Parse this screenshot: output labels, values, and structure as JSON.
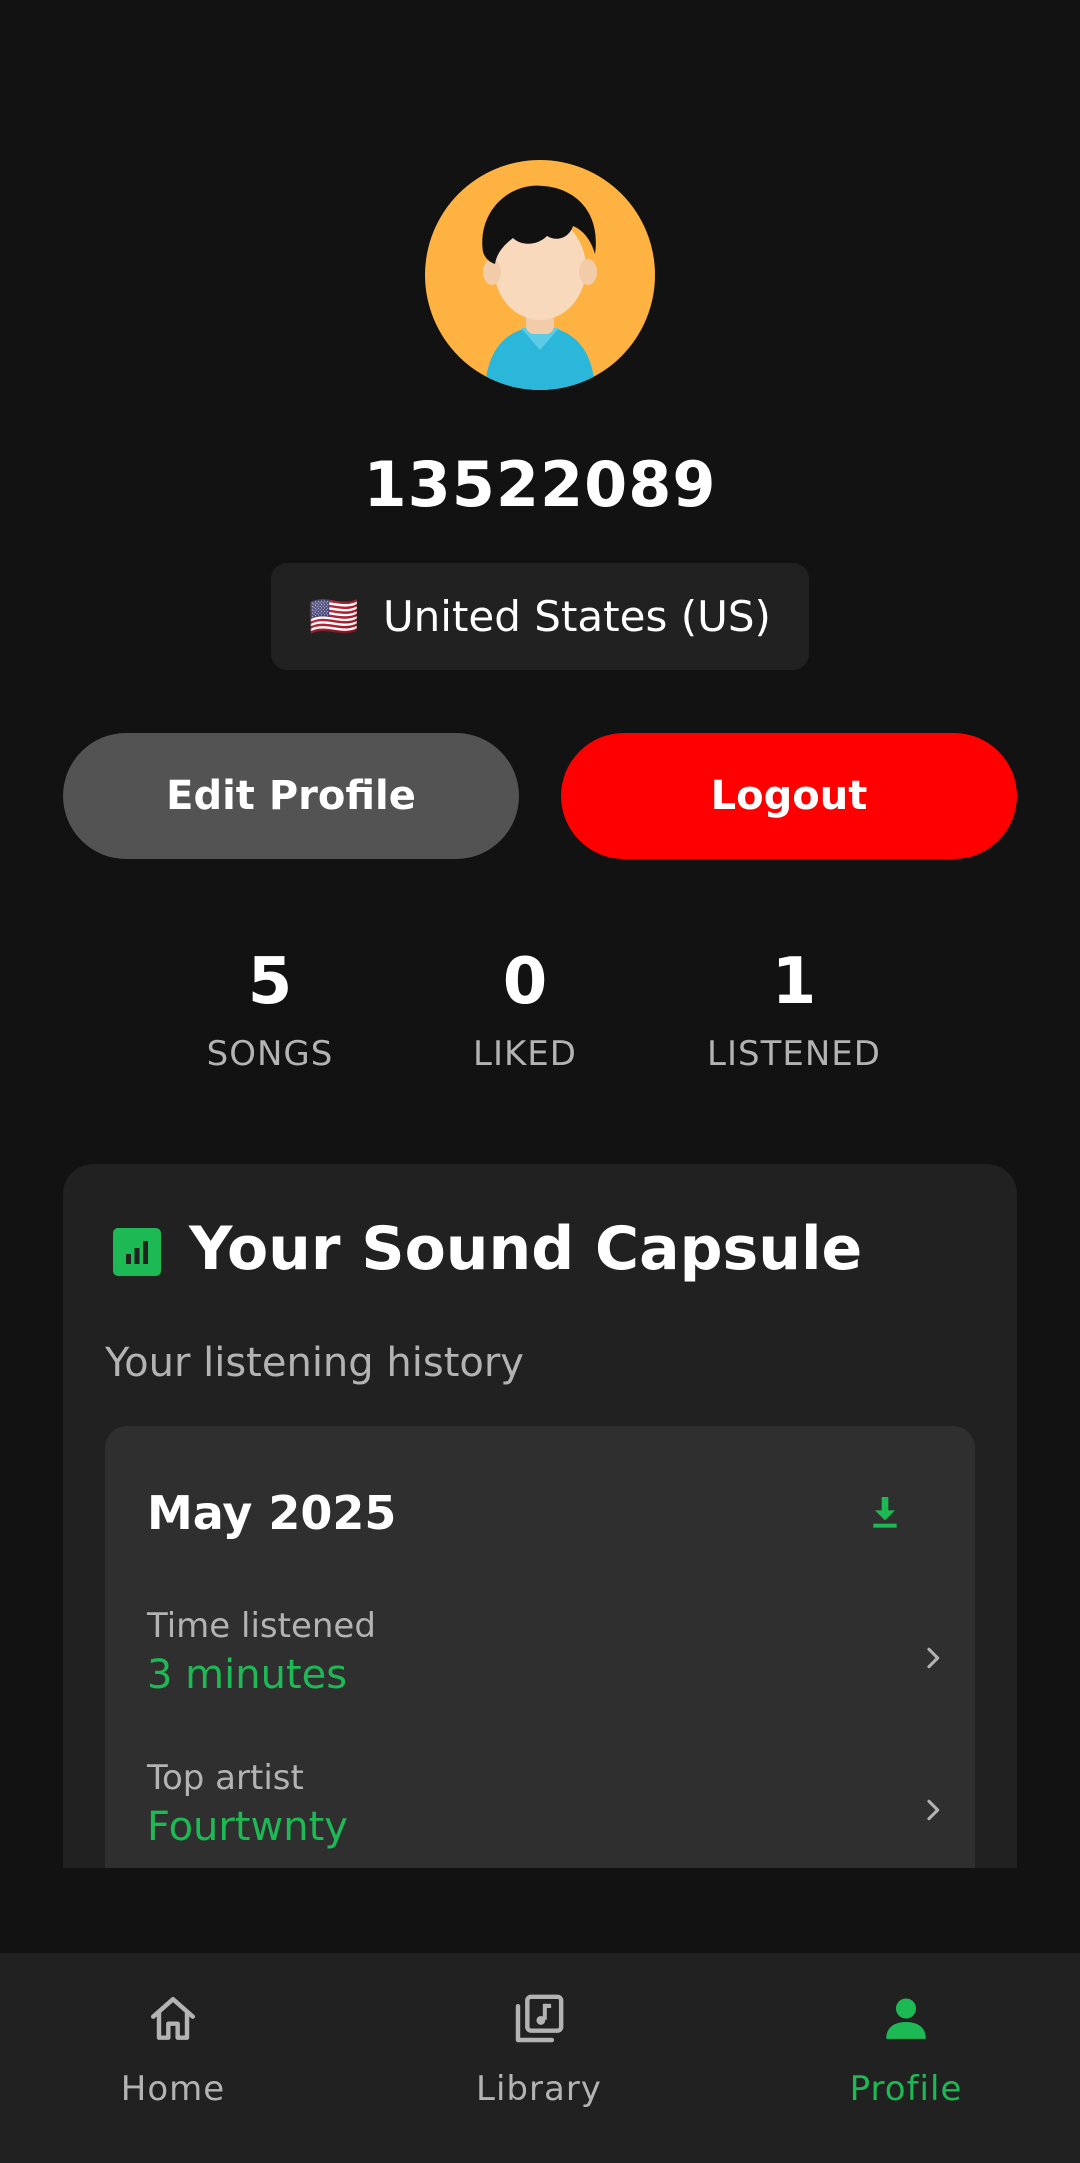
{
  "profile": {
    "username": "13522089",
    "country": {
      "flag": "🇺🇸",
      "label": "United States (US)"
    }
  },
  "actions": {
    "edit_label": "Edit Profile",
    "logout_label": "Logout"
  },
  "stats": [
    {
      "value": "5",
      "label": "SONGS"
    },
    {
      "value": "0",
      "label": "LIKED"
    },
    {
      "value": "1",
      "label": "LISTENED"
    }
  ],
  "capsule": {
    "icon": "bar-chart-icon",
    "title": "Your Sound Capsule",
    "subtitle": "Your listening history",
    "month": {
      "title": "May 2025",
      "download_icon": "download-icon",
      "rows": [
        {
          "label": "Time listened",
          "value": "3 minutes"
        },
        {
          "label": "Top artist",
          "value": "Fourtwnty"
        }
      ]
    }
  },
  "nav": {
    "items": [
      {
        "label": "Home",
        "icon": "home-icon",
        "active": false
      },
      {
        "label": "Library",
        "icon": "library-icon",
        "active": false
      },
      {
        "label": "Profile",
        "icon": "person-icon",
        "active": true
      }
    ]
  },
  "colors": {
    "background": "#121212",
    "surface": "#212121",
    "card": "#2f2f2f",
    "accent": "#1DB954",
    "logout": "#FF0000",
    "edit_button": "#535353",
    "avatar_bg": "#FDB241"
  }
}
